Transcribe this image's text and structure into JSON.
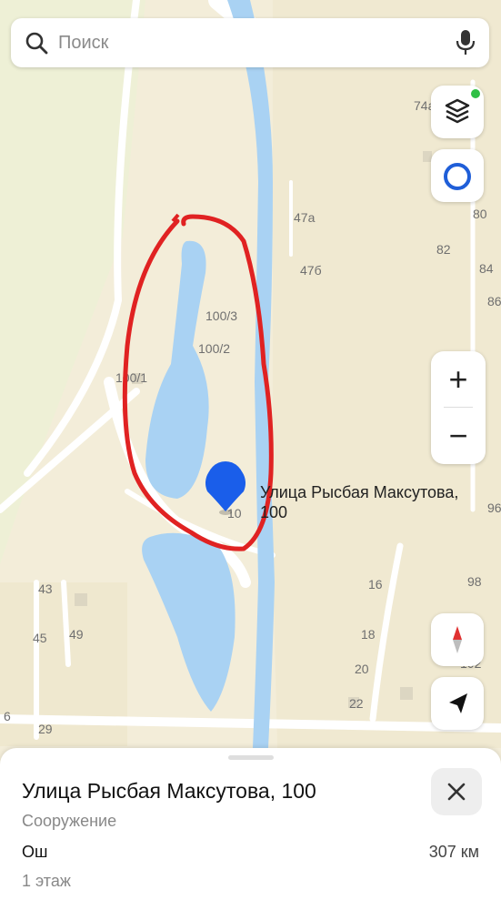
{
  "search": {
    "placeholder": "Поиск"
  },
  "map": {
    "place_label": [
      "Улица Рысбая Максутова,",
      "100"
    ],
    "house_numbers": [
      "74а",
      "80",
      "82",
      "84",
      "86",
      "47а",
      "47б",
      "100/3",
      "100/2",
      "100/1",
      "10",
      "96",
      "98",
      "16",
      "18",
      "20",
      "22",
      "102",
      "43",
      "45",
      "49",
      "29",
      "6"
    ],
    "colors": {
      "river": "#a9d2f3",
      "marker": "#1a5eea",
      "highlight_stroke": "#e02222",
      "land": "#f3edd9"
    }
  },
  "controls": {
    "zoom_in": "+",
    "zoom_out": "−",
    "layers_icon": "layers-icon",
    "location_icon": "my-location-icon",
    "compass_icon": "compass-icon",
    "navigate_icon": "navigation-arrow-icon"
  },
  "card": {
    "title": "Улица Рысбая Максутова, 100",
    "type": "Сооружение",
    "city": "Ош",
    "distance": "307 км",
    "floors": "1 этаж"
  }
}
